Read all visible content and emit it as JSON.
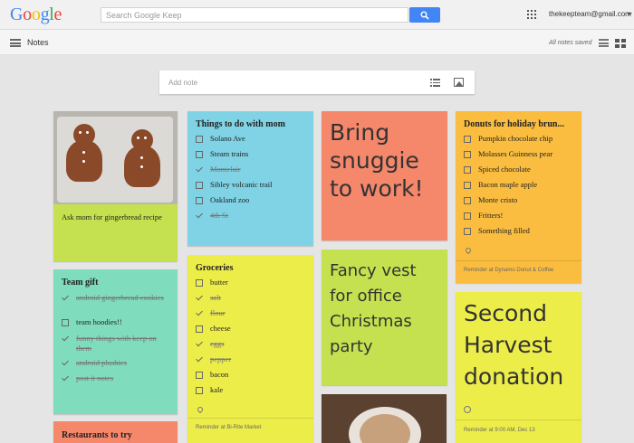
{
  "header": {
    "logo_letters": [
      {
        "ch": "G",
        "color": "#4285f4"
      },
      {
        "ch": "o",
        "color": "#ea4335"
      },
      {
        "ch": "o",
        "color": "#fbbc05"
      },
      {
        "ch": "g",
        "color": "#4285f4"
      },
      {
        "ch": "l",
        "color": "#34a853"
      },
      {
        "ch": "e",
        "color": "#ea4335"
      }
    ],
    "search_placeholder": "Search Google Keep",
    "account": "thekeepteam@gmail.com"
  },
  "subbar": {
    "title": "Notes",
    "status": "All notes saved"
  },
  "add_note": {
    "placeholder": "Add note"
  },
  "notes": {
    "gingerbread": {
      "color": "#c6e14f",
      "text": "Ask mom for gingerbread recipe"
    },
    "things_mom": {
      "color": "#7fd3e5",
      "title": "Things to do with mom",
      "items": [
        {
          "text": "Solano Ave",
          "done": false
        },
        {
          "text": "Steam trains",
          "done": false
        },
        {
          "text": "Montclair",
          "done": true
        },
        {
          "text": "Sibley volcanic trail",
          "done": false
        },
        {
          "text": "Oakland zoo",
          "done": false
        },
        {
          "text": "4th St",
          "done": true
        }
      ]
    },
    "snuggie": {
      "color": "#f5876b",
      "text": "Bring snuggie to work!"
    },
    "donuts": {
      "color": "#fbbd3f",
      "title": "Donuts for holiday brun...",
      "items": [
        {
          "text": "Pumpkin chocolate chip",
          "done": false
        },
        {
          "text": "Molasses Guinness pear",
          "done": false
        },
        {
          "text": "Spiced chocolate",
          "done": false
        },
        {
          "text": "Bacon maple apple",
          "done": false
        },
        {
          "text": "Monte cristo",
          "done": false
        },
        {
          "text": "Fritters!",
          "done": false
        },
        {
          "text": "Something filled",
          "done": false
        }
      ],
      "reminder": "Reminder at Dynamo Donut & Coffee"
    },
    "team_gift": {
      "color": "#7fdcbd",
      "title": "Team gift",
      "items": [
        {
          "text": "android gingerbread cookies",
          "done": true
        },
        {
          "text": "team hoodies!!",
          "done": false
        },
        {
          "text": "funny things with keep on them",
          "done": true
        },
        {
          "text": "android plushies",
          "done": true
        },
        {
          "text": "post it notes",
          "done": true
        }
      ]
    },
    "groceries": {
      "color": "#eded4a",
      "title": "Groceries",
      "items": [
        {
          "text": "butter",
          "done": false
        },
        {
          "text": "salt",
          "done": true
        },
        {
          "text": "flour",
          "done": true
        },
        {
          "text": "cheese",
          "done": false
        },
        {
          "text": "eggs",
          "done": true
        },
        {
          "text": "pepper",
          "done": true
        },
        {
          "text": "bacon",
          "done": false
        },
        {
          "text": "kale",
          "done": false
        }
      ],
      "reminder": "Reminder at Bi-Rite Market"
    },
    "fancy_vest": {
      "color": "#c6e14f",
      "text": "Fancy vest for office Christmas party"
    },
    "second_harvest": {
      "color": "#eded4a",
      "text": "Second Harvest donation",
      "reminder": "Reminder at 9:00 AM, Dec 13"
    },
    "restaurants": {
      "color": "#f5876b",
      "title": "Restaurants to try"
    }
  }
}
